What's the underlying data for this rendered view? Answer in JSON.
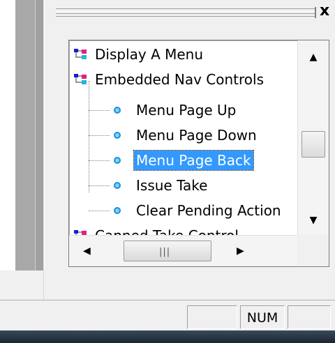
{
  "window": {
    "close_glyph": "x"
  },
  "tree": {
    "items": [
      {
        "label": "Display A Menu",
        "type": "folder"
      },
      {
        "label": "Embedded Nav Controls",
        "type": "folder"
      },
      {
        "label": "Menu Page Up",
        "type": "leaf"
      },
      {
        "label": "Menu Page Down",
        "type": "leaf"
      },
      {
        "label": "Menu Page Back",
        "type": "leaf",
        "selected": true
      },
      {
        "label": "Issue Take",
        "type": "leaf"
      },
      {
        "label": "Clear Pending Action",
        "type": "leaf"
      },
      {
        "label": "Canned Take Control",
        "type": "folder"
      }
    ],
    "colors": {
      "selection": "#3399ff",
      "bullet": "#1c8fd6"
    }
  },
  "statusbar": {
    "num_label": "NUM"
  }
}
